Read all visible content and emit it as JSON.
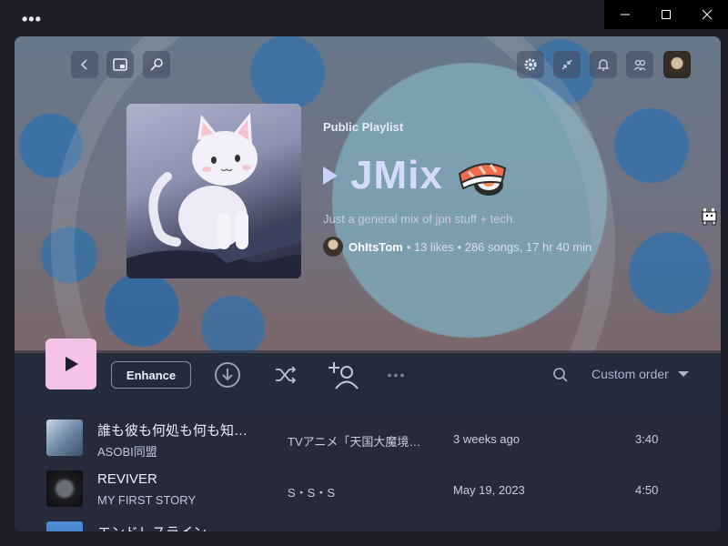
{
  "window": {
    "menu_dots": "•••"
  },
  "playlist": {
    "type_label": "Public Playlist",
    "title": "JMix",
    "description": "Just a general mix of jpn stuff + tech.",
    "owner": "OhItsTom",
    "stats": "• 13 likes • 286 songs, 17 hr 40 min"
  },
  "controls": {
    "enhance_label": "Enhance",
    "more_label": "•••",
    "sort_label": "Custom order"
  },
  "tracks": [
    {
      "title": "誰も彼も何処も何も知…",
      "artist": "ASOBI同盟",
      "album": "TVアニメ「天国大魔境…",
      "added": "3 weeks ago",
      "duration": "3:40"
    },
    {
      "title": "REVIVER",
      "artist": "MY FIRST STORY",
      "album": "S・S・S",
      "added": "May 19, 2023",
      "duration": "4:50"
    },
    {
      "title": "エンドレスライン",
      "artist": "",
      "album": "",
      "added": "",
      "duration": ""
    }
  ],
  "colors": {
    "accent": "#f5c2e7",
    "title": "#d4dbff",
    "bg": "#1e1f2b"
  }
}
